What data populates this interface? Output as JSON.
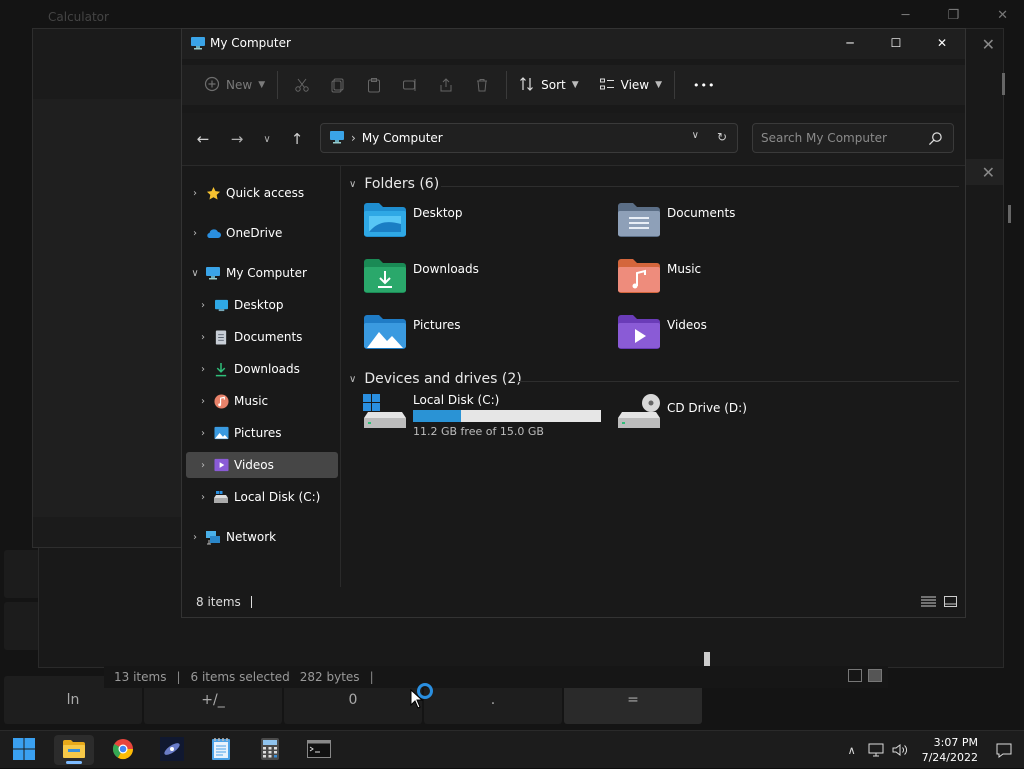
{
  "background": {
    "ghost_title": "Calculator",
    "status": {
      "items_count": "13 items",
      "selected": "6 items selected",
      "size": "282 bytes"
    },
    "calc_keys": [
      "ln",
      "+/_",
      "0",
      ".",
      "="
    ]
  },
  "explorer": {
    "title": "My Computer",
    "window_controls": {
      "minimize": "─",
      "maximize": "☐",
      "close": "✕"
    },
    "toolbar": {
      "new_label": "New",
      "sort_label": "Sort",
      "view_label": "View",
      "more_label": "•••"
    },
    "address": {
      "path": "My Computer",
      "search_placeholder": "Search My Computer"
    },
    "sidebar": {
      "items": [
        {
          "label": "Quick access",
          "icon": "star-icon"
        },
        {
          "label": "OneDrive",
          "icon": "cloud-icon"
        },
        {
          "label": "My Computer",
          "icon": "computer-icon"
        },
        {
          "label": "Desktop",
          "icon": "desktop-icon"
        },
        {
          "label": "Documents",
          "icon": "documents-icon"
        },
        {
          "label": "Downloads",
          "icon": "download-icon"
        },
        {
          "label": "Music",
          "icon": "music-icon"
        },
        {
          "label": "Pictures",
          "icon": "pictures-icon"
        },
        {
          "label": "Videos",
          "icon": "videos-icon"
        },
        {
          "label": "Local Disk (C:)",
          "icon": "disk-icon"
        },
        {
          "label": "Network",
          "icon": "network-icon"
        }
      ],
      "selected": "Videos"
    },
    "folders": {
      "header": "Folders (6)",
      "items": [
        {
          "name": "Desktop",
          "color": "#2fa8e5"
        },
        {
          "name": "Documents",
          "color": "#7f93ad"
        },
        {
          "name": "Downloads",
          "color": "#2aa86b"
        },
        {
          "name": "Music",
          "color": "#e8826a"
        },
        {
          "name": "Pictures",
          "color": "#3a9ae0"
        },
        {
          "name": "Videos",
          "color": "#8a5bd6"
        }
      ]
    },
    "drives": {
      "header": "Devices and drives (2)",
      "items": [
        {
          "name": "Local Disk (C:)",
          "free_text": "11.2 GB free of 15.0 GB",
          "used_fraction": 0.253
        },
        {
          "name": "CD Drive (D:)"
        }
      ]
    },
    "status": {
      "items_count": "8 items"
    }
  },
  "taskbar": {
    "apps": [
      "start-icon",
      "file-explorer-icon",
      "chrome-icon",
      "space-app-icon",
      "notepad-icon",
      "calculator-icon",
      "terminal-icon"
    ],
    "time": "3:07 PM",
    "date": "7/24/2022"
  },
  "colors": {
    "accent": "#2a93d5",
    "window_bg": "#191919",
    "selected_bg": "#464646"
  }
}
